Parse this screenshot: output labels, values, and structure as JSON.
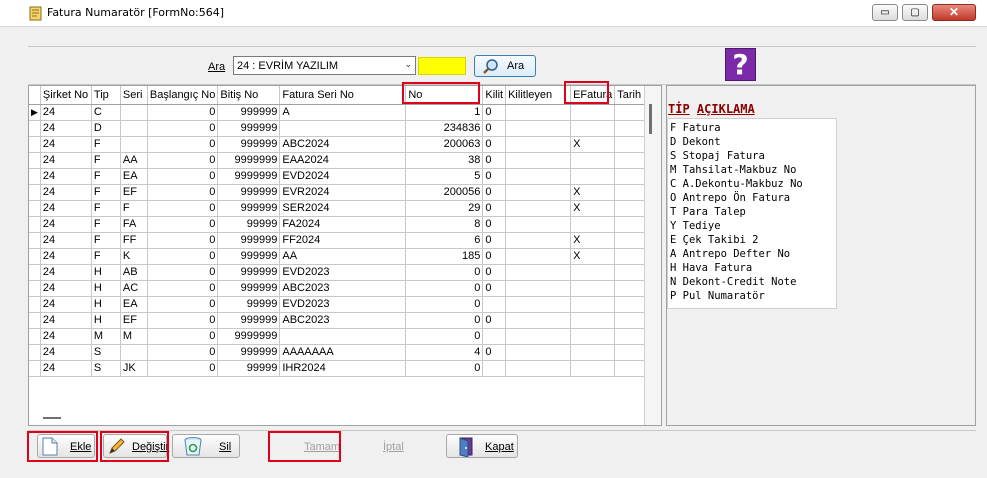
{
  "window": {
    "title": "Fatura Numaratör [FormNo:564]",
    "buttons": {
      "minimize": "▭",
      "maximize": "▢",
      "close": "✕"
    }
  },
  "search": {
    "label": "Ara",
    "selected_company": "24 : EVRİM YAZILIM",
    "button_label": "Ara",
    "help_glyph": "?"
  },
  "grid": {
    "columns": [
      "Şirket No",
      "Tip",
      "Seri",
      "Başlangıç No",
      "Bitiş No",
      "Fatura Seri No",
      "No",
      "Kilit",
      "Kilitleyen",
      "EFatura",
      "Tarih"
    ],
    "rows": [
      [
        "24",
        "C",
        "",
        "0",
        "999999",
        "A",
        "1",
        "0",
        "",
        "",
        ""
      ],
      [
        "24",
        "D",
        "",
        "0",
        "999999",
        "",
        "234836",
        "0",
        "",
        "",
        ""
      ],
      [
        "24",
        "F",
        "",
        "0",
        "999999",
        "ABC2024",
        "200063",
        "0",
        "",
        "X",
        ""
      ],
      [
        "24",
        "F",
        "AA",
        "0",
        "9999999",
        "EAA2024",
        "38",
        "0",
        "",
        "",
        ""
      ],
      [
        "24",
        "F",
        "EA",
        "0",
        "9999999",
        "EVD2024",
        "5",
        "0",
        "",
        "",
        ""
      ],
      [
        "24",
        "F",
        "EF",
        "0",
        "999999",
        "EVR2024",
        "200056",
        "0",
        "",
        "X",
        ""
      ],
      [
        "24",
        "F",
        "F",
        "0",
        "999999",
        "SER2024",
        "29",
        "0",
        "",
        "X",
        ""
      ],
      [
        "24",
        "F",
        "FA",
        "0",
        "99999",
        "FA2024",
        "8",
        "0",
        "",
        "",
        ""
      ],
      [
        "24",
        "F",
        "FF",
        "0",
        "999999",
        "FF2024",
        "6",
        "0",
        "",
        "X",
        ""
      ],
      [
        "24",
        "F",
        "K",
        "0",
        "999999",
        "AA",
        "185",
        "0",
        "",
        "X",
        ""
      ],
      [
        "24",
        "H",
        "AB",
        "0",
        "999999",
        "EVD2023",
        "0",
        "0",
        "",
        "",
        ""
      ],
      [
        "24",
        "H",
        "AC",
        "0",
        "999999",
        "ABC2023",
        "0",
        "0",
        "",
        "",
        ""
      ],
      [
        "24",
        "H",
        "EA",
        "0",
        "99999",
        "EVD2023",
        "0",
        "",
        "",
        "",
        ""
      ],
      [
        "24",
        "H",
        "EF",
        "0",
        "999999",
        "ABC2023",
        "0",
        "0",
        "",
        "",
        ""
      ],
      [
        "24",
        "M",
        "M",
        "0",
        "9999999",
        "",
        "0",
        "",
        "",
        "",
        ""
      ],
      [
        "24",
        "S",
        "",
        "0",
        "999999",
        "AAAAAAA",
        "4",
        "0",
        "",
        "",
        ""
      ],
      [
        "24",
        "S",
        "JK",
        "0",
        "99999",
        "IHR2024",
        "0",
        "",
        "",
        "",
        ""
      ]
    ],
    "current_row_marker": "▶"
  },
  "legend": {
    "header_tip": "TİP",
    "header_desc": "AÇIKLAMA",
    "items": [
      "F Fatura",
      "D Dekont",
      "S Stopaj Fatura",
      "M Tahsilat-Makbuz No",
      "C A.Dekontu-Makbuz No",
      "O Antrepo Ön Fatura",
      "T Para Talep",
      "Y Tediye",
      "E Çek Takibi 2",
      "A Antrepo Defter No",
      "H Hava Fatura",
      "N Dekont-Credit Note",
      "P Pul Numaratör"
    ]
  },
  "toolbar": {
    "ekle": "Ekle",
    "degistir": "Değiştir",
    "sil": "Sil",
    "tamam": "Tamam",
    "iptal": "İptal",
    "kapat": "Kapat"
  }
}
